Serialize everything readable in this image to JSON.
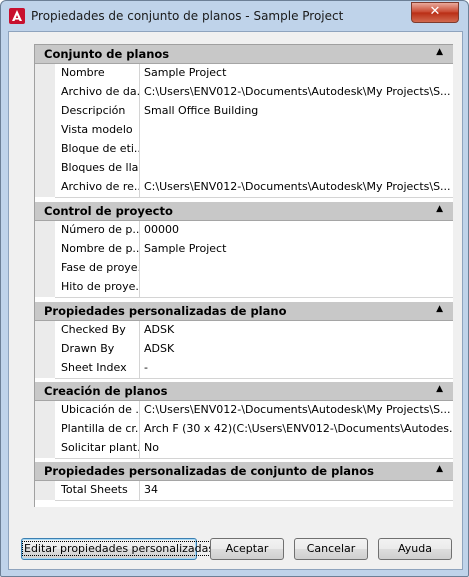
{
  "window": {
    "title": "Propiedades de conjunto de planos - Sample Project",
    "close_label": "✕"
  },
  "sections": [
    {
      "title": "Conjunto de planos",
      "rows": [
        {
          "name": "Nombre",
          "value": "Sample Project"
        },
        {
          "name": "Archivo de da...",
          "value": "C:\\Users\\ENV012-\\Documents\\Autodesk\\My Projects\\S..."
        },
        {
          "name": "Descripción",
          "value": "Small Office Building"
        },
        {
          "name": "Vista modelo",
          "value": ""
        },
        {
          "name": "Bloque de eti...",
          "value": ""
        },
        {
          "name": "Bloques de lla...",
          "value": ""
        },
        {
          "name": "Archivo de re...",
          "value": "C:\\Users\\ENV012-\\Documents\\Autodesk\\My Projects\\S..."
        }
      ]
    },
    {
      "title": "Control de proyecto",
      "rows": [
        {
          "name": "Número de p...",
          "value": "00000"
        },
        {
          "name": "Nombre de p...",
          "value": "Sample Project"
        },
        {
          "name": "Fase de proye...",
          "value": ""
        },
        {
          "name": "Hito de proye...",
          "value": ""
        }
      ]
    },
    {
      "title": "Propiedades personalizadas de plano",
      "rows": [
        {
          "name": "Checked By",
          "value": "ADSK"
        },
        {
          "name": "Drawn By",
          "value": "ADSK"
        },
        {
          "name": "Sheet Index",
          "value": "-"
        }
      ]
    },
    {
      "title": "Creación de planos",
      "rows": [
        {
          "name": "Ubicación de ...",
          "value": "C:\\Users\\ENV012-\\Documents\\Autodesk\\My Projects\\S..."
        },
        {
          "name": "Plantilla de cr...",
          "value": "Arch F (30 x 42)(C:\\Users\\ENV012-\\Documents\\Autodes..."
        },
        {
          "name": "Solicitar plant...",
          "value": "No"
        }
      ]
    },
    {
      "title": "Propiedades personalizadas de conjunto de planos",
      "rows": [
        {
          "name": "Total Sheets",
          "value": "34"
        }
      ]
    }
  ],
  "collapse_glyph": "▲",
  "buttons": {
    "edit_custom": "Editar propiedades personalizadas...",
    "accept": "Aceptar",
    "cancel": "Cancelar",
    "help": "Ayuda"
  }
}
